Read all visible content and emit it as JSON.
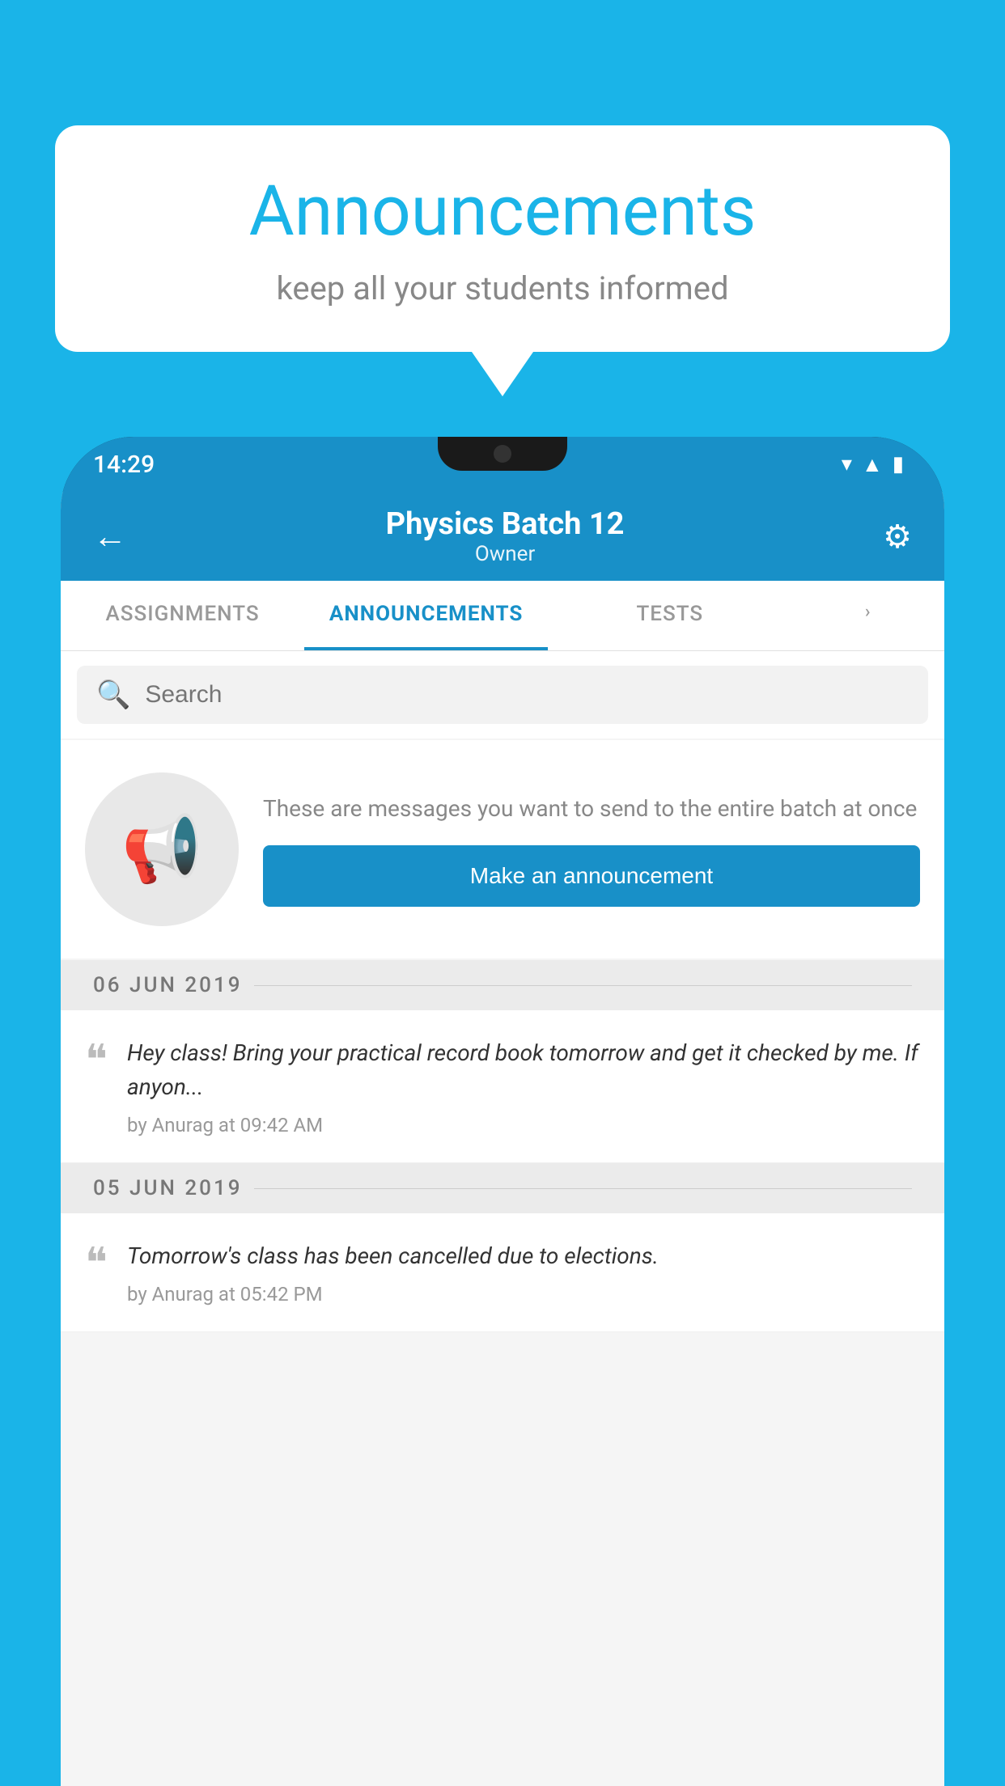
{
  "background_color": "#1ab4e8",
  "speech_bubble": {
    "title": "Announcements",
    "subtitle": "keep all your students informed"
  },
  "status_bar": {
    "time": "14:29",
    "icons": [
      "wifi",
      "signal",
      "battery"
    ]
  },
  "app_bar": {
    "title": "Physics Batch 12",
    "subtitle": "Owner",
    "back_label": "←",
    "settings_label": "⚙"
  },
  "tabs": [
    {
      "label": "ASSIGNMENTS",
      "active": false
    },
    {
      "label": "ANNOUNCEMENTS",
      "active": true
    },
    {
      "label": "TESTS",
      "active": false
    },
    {
      "label": "›",
      "active": false
    }
  ],
  "search": {
    "placeholder": "Search"
  },
  "promo": {
    "description": "These are messages you want to send to the entire batch at once",
    "button_label": "Make an announcement"
  },
  "announcements": [
    {
      "date": "06  JUN  2019",
      "items": [
        {
          "message": "Hey class! Bring your practical record book tomorrow and get it checked by me. If anyon...",
          "author": "by Anurag at 09:42 AM"
        }
      ]
    },
    {
      "date": "05  JUN  2019",
      "items": [
        {
          "message": "Tomorrow's class has been cancelled due to elections.",
          "author": "by Anurag at 05:42 PM"
        }
      ]
    }
  ]
}
